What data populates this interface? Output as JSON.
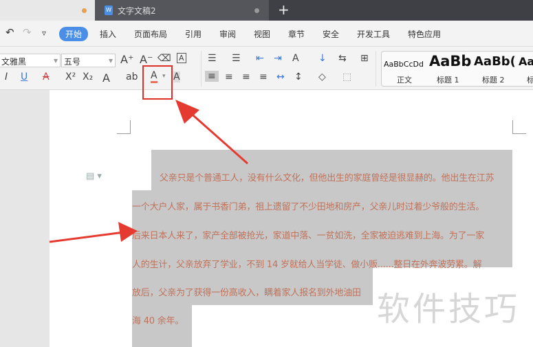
{
  "tabs": {
    "active_title": "文字文稿2"
  },
  "menu": {
    "items": [
      "开始",
      "插入",
      "页面布局",
      "引用",
      "审阅",
      "视图",
      "章节",
      "安全",
      "开发工具",
      "特色应用"
    ],
    "active": "开始"
  },
  "toolbar": {
    "font_name": "微软雅黑",
    "font_name_visible": "文雅黑",
    "font_size": "五号",
    "highlighted_button": "font-color"
  },
  "styles": [
    {
      "sample": "AaBbCcDd",
      "label": "正文"
    },
    {
      "sample": "AaBb",
      "label": "标题 1"
    },
    {
      "sample": "AaBb(",
      "label": "标题 2"
    },
    {
      "sample": "Aa",
      "label": "标"
    }
  ],
  "document": {
    "lines": [
      "父亲只是个普通工人，没有什么文化，但他出生的家庭曾经是很显赫的。他出生在江苏",
      "一个大户人家，属于书香门弟，祖上遗留了不少田地和房产，父亲儿时过着少爷般的生活。",
      "后来日本人来了，家产全部被抢光，家道中落、一贫如洗，全家被迫逃难到上海。为了一家",
      "人的生计，父亲放弃了学业，不到 14 岁就给人当学徒、做小贩......整日在外奔波劳累。解",
      "放后，父亲为了获得一份高收入，瞒着家人报名到外地油田",
      "海 40 余年。"
    ],
    "text_color": "#c0725a",
    "selection_color": "#c8c8c8"
  },
  "watermark": "软件技巧",
  "colors": {
    "accent": "#4b8ee6",
    "annotation": "#e0302a"
  }
}
